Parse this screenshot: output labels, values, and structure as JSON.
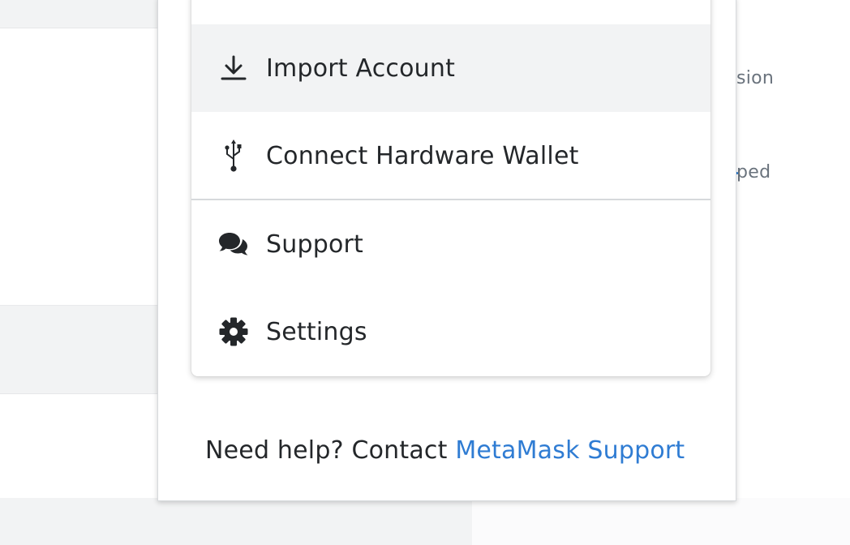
{
  "background": {
    "text_1": "sion",
    "text_2": "ped",
    "accent_color": "#1f73c9"
  },
  "menu": {
    "items": [
      {
        "label": "Import Account",
        "icon": "download-icon",
        "highlighted": true
      },
      {
        "label": "Connect Hardware Wallet",
        "icon": "usb-icon",
        "highlighted": false
      },
      {
        "label": "Support",
        "icon": "chat-bubbles-icon",
        "highlighted": false
      },
      {
        "label": "Settings",
        "icon": "gear-icon",
        "highlighted": false
      }
    ]
  },
  "help": {
    "prefix": "Need help? Contact ",
    "link_label": "MetaMask Support",
    "link_color": "#2f7cd3"
  }
}
